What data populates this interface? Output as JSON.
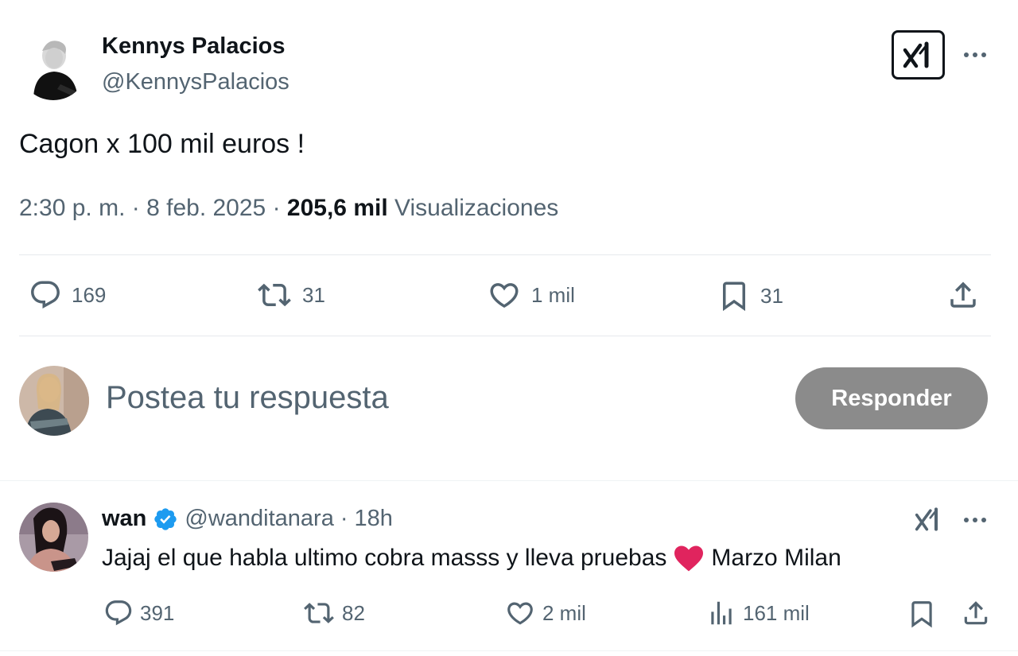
{
  "tweet": {
    "author_name": "Kennys Palacios",
    "author_handle": "@KennysPalacios",
    "text": "Cagon x 100 mil euros !",
    "time": "2:30 p. m.",
    "separator": "·",
    "date": "8 feb. 2025",
    "views_count": "205,6 mil",
    "views_label": "Visualizaciones",
    "actions": {
      "replies": "169",
      "reposts": "31",
      "likes": "1 mil",
      "bookmarks": "31"
    }
  },
  "composer": {
    "placeholder": "Postea tu respuesta",
    "reply_button": "Responder"
  },
  "reply": {
    "author_name": "wan",
    "author_handle": "@wanditanara",
    "separator": "·",
    "age": "18h",
    "text_before": "Jajaj el que habla ultimo cobra masss y lleva pruebas",
    "text_after": "Marzo Milan",
    "actions": {
      "replies": "391",
      "reposts": "82",
      "likes": "2 mil",
      "views": "161 mil"
    }
  },
  "colors": {
    "text_primary": "#0f1419",
    "text_secondary": "#536471",
    "verified_blue": "#1d9bf0",
    "heart_red": "#e0245e",
    "reply_button_bg": "#8b8b8b"
  },
  "icons": [
    "grok-icon",
    "more-icon",
    "reply-icon",
    "repost-icon",
    "like-icon",
    "bookmark-icon",
    "share-icon",
    "views-icon",
    "verified-badge-icon",
    "heart-emoji-icon"
  ]
}
